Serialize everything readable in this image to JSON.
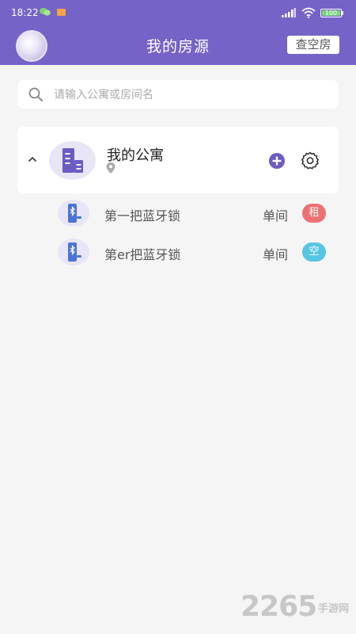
{
  "status_bar": {
    "time": "18:22",
    "battery_text": "100",
    "battery_level": 1.0
  },
  "header": {
    "title": "我的房源",
    "check_vacancy_label": "查空房"
  },
  "search": {
    "placeholder": "请输入公寓或房间名",
    "value": ""
  },
  "apartment": {
    "name": "我的公寓"
  },
  "locks": [
    {
      "name": "第一把蓝牙锁",
      "type": "单间",
      "status": "租",
      "status_color": "#ec7174"
    },
    {
      "name": "第er把蓝牙锁",
      "type": "单间",
      "status": "空",
      "status_color": "#56c6e3"
    }
  ],
  "watermark": {
    "number": "2265",
    "text": "手游网"
  },
  "colors": {
    "accent": "#7563c7",
    "background": "#f5f5f5"
  }
}
